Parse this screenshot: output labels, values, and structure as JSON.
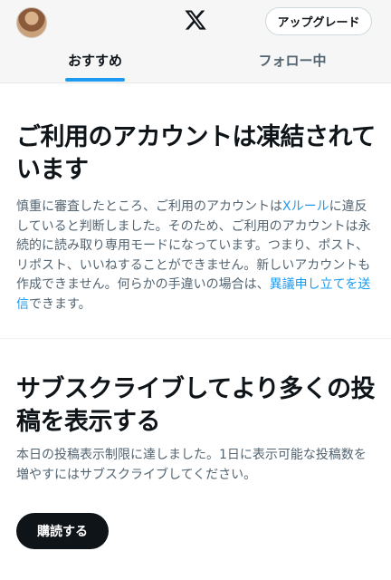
{
  "header": {
    "logo_icon": "x-logo-icon",
    "upgrade_label": "アップグレード"
  },
  "tabs": [
    {
      "label": "おすすめ",
      "active": true
    },
    {
      "label": "フォロー中",
      "active": false
    }
  ],
  "suspension": {
    "title": "ご利用のアカウントは凍結されています",
    "body_part1": "慎重に審査したところ、ご利用のアカウントは",
    "rules_link": "Xルール",
    "body_part2": "に違反していると判断しました。そのため、ご利用のアカウントは永続的に読み取り専用モードになっています。つまり、ポスト、リポスト、いいねすることができません。新しいアカウントも作成できません。何らかの手違いの場合は、",
    "appeal_link": "異議申し立てを送信",
    "body_part3": "できます。"
  },
  "subscribe_prompt": {
    "title": "サブスクライブしてより多くの投稿を表示する",
    "body": "本日の投稿表示制限に達しました。1日に表示可能な投稿数を増やすにはサブスクライブしてください。",
    "button_label": "購読する"
  },
  "colors": {
    "accent": "#1d9bf0",
    "text_primary": "#0f1419",
    "text_secondary": "#536471"
  }
}
